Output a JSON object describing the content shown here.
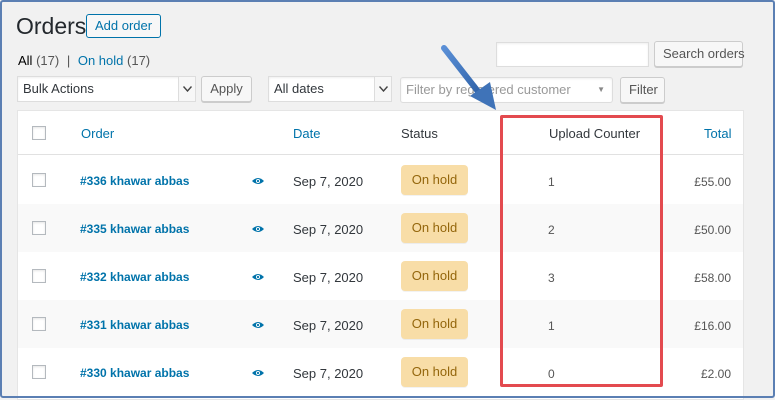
{
  "header": {
    "title": "Orders",
    "add_order_label": "Add order"
  },
  "views": {
    "all_label": "All",
    "all_count": "(17)",
    "separator": "|",
    "on_hold_label": "On hold",
    "on_hold_count": "(17)"
  },
  "search": {
    "value": "",
    "button_label": "Search orders"
  },
  "filters": {
    "bulk_actions": "Bulk Actions",
    "apply_label": "Apply",
    "dates": "All dates",
    "customer_placeholder": "Filter by registered customer",
    "filter_label": "Filter"
  },
  "table": {
    "columns": {
      "order": "Order",
      "date": "Date",
      "status": "Status",
      "upload_counter": "Upload Counter",
      "total": "Total"
    },
    "rows": [
      {
        "order": "#336 khawar abbas",
        "date": "Sep 7, 2020",
        "status": "On hold",
        "upload_counter": "1",
        "total": "£55.00"
      },
      {
        "order": "#335 khawar abbas",
        "date": "Sep 7, 2020",
        "status": "On hold",
        "upload_counter": "2",
        "total": "£50.00"
      },
      {
        "order": "#332 khawar abbas",
        "date": "Sep 7, 2020",
        "status": "On hold",
        "upload_counter": "3",
        "total": "£58.00"
      },
      {
        "order": "#331 khawar abbas",
        "date": "Sep 7, 2020",
        "status": "On hold",
        "upload_counter": "1",
        "total": "£16.00"
      },
      {
        "order": "#330 khawar abbas",
        "date": "Sep 7, 2020",
        "status": "On hold",
        "upload_counter": "0",
        "total": "£2.00"
      }
    ]
  },
  "icons": {
    "preview": "eye-icon",
    "dropdown": "chevron-down-icon",
    "annotation_arrow": "arrow-icon"
  },
  "colors": {
    "link": "#0073aa",
    "on_hold_bg": "#f8dda7",
    "on_hold_text": "#94660c",
    "highlight": "#e34a4f",
    "annotation_arrow": "#3f73b8"
  }
}
